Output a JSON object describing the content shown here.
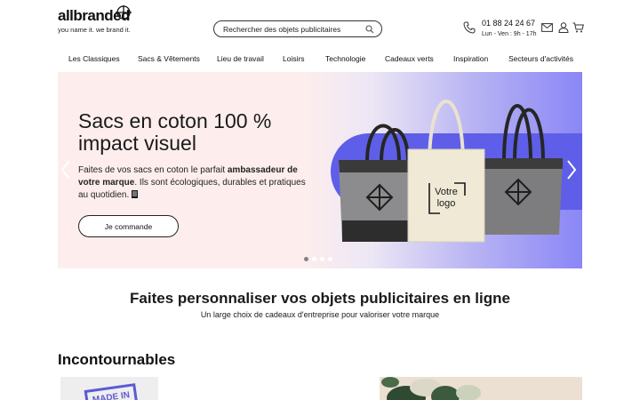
{
  "header": {
    "logo_text": "allbranded",
    "tagline": "you name it. we brand it.",
    "search_placeholder": "Rechercher des objets publicitaires",
    "phone_number": "01 88 24 24 67",
    "phone_hours": "Lun - Ven : 9h - 17h"
  },
  "nav": [
    {
      "label": "Les Classiques"
    },
    {
      "label": "Sacs & Vêtements"
    },
    {
      "label": "Lieu de travail"
    },
    {
      "label": "Loisirs"
    },
    {
      "label": "Technologie"
    },
    {
      "label": "Cadeaux verts"
    },
    {
      "label": "Inspiration"
    },
    {
      "label": "Secteurs d'activités"
    }
  ],
  "hero": {
    "title_line1": "Sacs en coton 100 %",
    "title_line2": "impact visuel",
    "text_part1": "Faites de vos sacs en coton le parfait ",
    "text_bold": "ambassadeur de votre marque",
    "text_part2": ". Ils sont écologiques, durables et pratiques au quotidien.",
    "cta": "Je commande",
    "bag_label_1": "Votre",
    "bag_label_2": "logo",
    "slides_total": 4,
    "active_slide": 1
  },
  "section": {
    "title": "Faites personnaliser vos objets publicitaires en ligne",
    "subtitle": "Un large choix de cadeaux d'entreprise pour valoriser votre marque"
  },
  "incontournables": {
    "title": "Incontournables",
    "badge_text": "MADE IN"
  },
  "colors": {
    "accent": "#5f5ee8",
    "hero_bg": "#fdeeed"
  }
}
